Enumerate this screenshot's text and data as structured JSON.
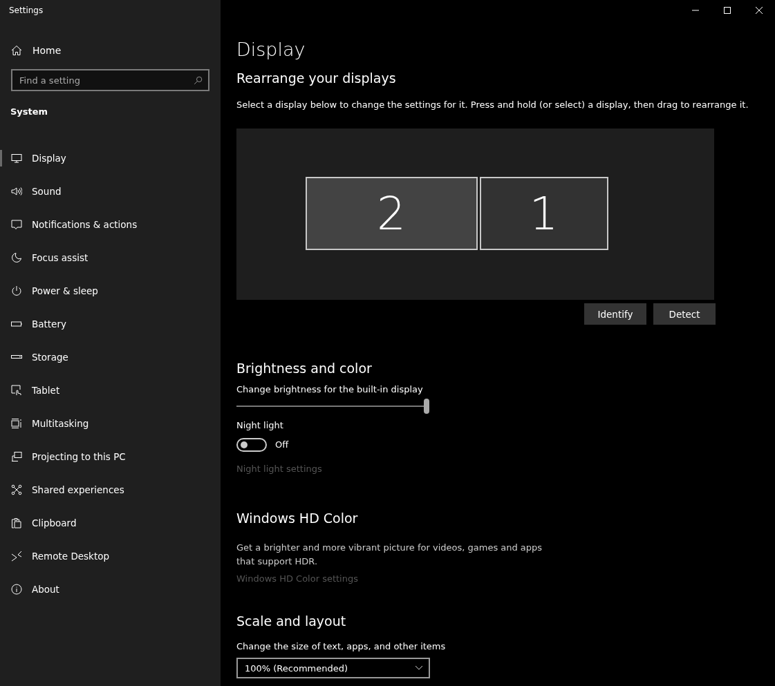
{
  "window": {
    "title": "Settings"
  },
  "sidebar": {
    "home": "Home",
    "search": {
      "placeholder": "Find a setting"
    },
    "section": "System",
    "items": [
      {
        "label": "Display",
        "selected": true
      },
      {
        "label": "Sound",
        "selected": false
      },
      {
        "label": "Notifications & actions",
        "selected": false
      },
      {
        "label": "Focus assist",
        "selected": false
      },
      {
        "label": "Power & sleep",
        "selected": false
      },
      {
        "label": "Battery",
        "selected": false
      },
      {
        "label": "Storage",
        "selected": false
      },
      {
        "label": "Tablet",
        "selected": false
      },
      {
        "label": "Multitasking",
        "selected": false
      },
      {
        "label": "Projecting to this PC",
        "selected": false
      },
      {
        "label": "Shared experiences",
        "selected": false
      },
      {
        "label": "Clipboard",
        "selected": false
      },
      {
        "label": "Remote Desktop",
        "selected": false
      },
      {
        "label": "About",
        "selected": false
      }
    ]
  },
  "page": {
    "title": "Display",
    "arrange": {
      "heading": "Rearrange your displays",
      "description": "Select a display below to change the settings for it. Press and hold (or select) a display, then drag to rearrange it.",
      "monitors": [
        {
          "label": "2",
          "selected": true
        },
        {
          "label": "1",
          "selected": false
        }
      ],
      "buttons": [
        "Identify",
        "Detect"
      ]
    },
    "brightness": {
      "heading": "Brightness and color",
      "slider_label": "Change brightness for the built-in display",
      "level": 1.0,
      "night_light": {
        "label": "Night light",
        "on": false,
        "state_text": "Off"
      },
      "link": "Night light settings"
    },
    "hd_color": {
      "heading": "Windows HD Color",
      "description": "Get a brighter and more vibrant picture for videos, games and apps that support HDR.",
      "link": "Windows HD Color settings"
    },
    "scale": {
      "heading": "Scale and layout",
      "label": "Change the size of text, apps, and other items",
      "value": "100% (Recommended)"
    }
  }
}
